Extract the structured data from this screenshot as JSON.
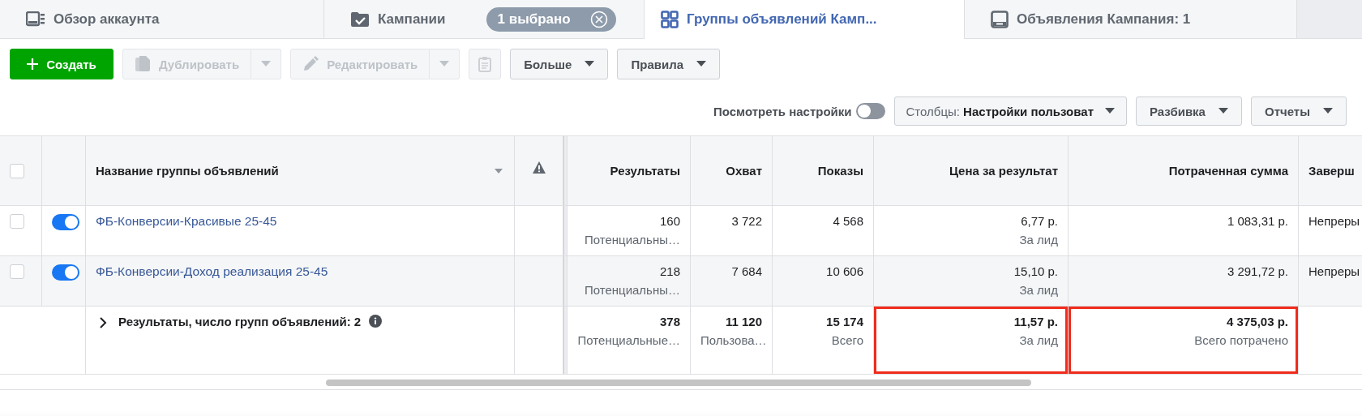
{
  "tabs": [
    {
      "kind": "account",
      "label": "Обзор аккаунта",
      "selected": false
    },
    {
      "kind": "campaigns",
      "label": "Кампании",
      "badge": "1 выбрано",
      "selected": false
    },
    {
      "kind": "adsets",
      "label": "Группы объявлений Камп...",
      "selected": true
    },
    {
      "kind": "ads",
      "label": "Объявления Кампания: 1",
      "selected": false
    }
  ],
  "toolbar": [
    {
      "kind": "create",
      "label": "Создать",
      "disabled": false
    },
    {
      "kind": "duplicate",
      "label": "Дублировать",
      "disabled": true
    },
    {
      "kind": "edit",
      "label": "Редактировать",
      "disabled": true
    },
    {
      "kind": "paste",
      "disabled": true
    },
    {
      "kind": "menu",
      "label": "Больше",
      "disabled": false
    },
    {
      "kind": "menu",
      "label": "Правила",
      "disabled": false
    }
  ],
  "view_settings": {
    "label": "Посмотреть настройки",
    "on": false
  },
  "view_options": [
    {
      "label": "Столбцы:",
      "value": "Настройки пользоват"
    },
    {
      "label": "Разбивка"
    },
    {
      "label": "Отчеты"
    }
  ],
  "table": {
    "select_all_checked": false,
    "columns": [
      {
        "kind": "name",
        "label": "Название группы объявлений"
      },
      {
        "kind": "warning"
      },
      {
        "kind": "number",
        "label": "Результаты"
      },
      {
        "kind": "number",
        "label": "Охват"
      },
      {
        "kind": "number",
        "label": "Показы"
      },
      {
        "kind": "number",
        "label": "Цена за результат"
      },
      {
        "kind": "number",
        "label": "Потраченная сумма"
      },
      {
        "kind": "text",
        "label": "Заверш"
      }
    ],
    "rows": [
      {
        "checked": false,
        "active": true,
        "cells": [
          {
            "value": "ФБ-Конверсии-Красивые 25-45"
          },
          {},
          {
            "value": "160",
            "sub": "Потенциальны…"
          },
          {
            "value": "3 722"
          },
          {
            "value": "4 568"
          },
          {
            "value": "6,77 р.",
            "sub": "За лид"
          },
          {
            "value": "1 083,31 р."
          },
          {
            "value": "Непреры"
          }
        ]
      },
      {
        "checked": false,
        "active": true,
        "cells": [
          {
            "value": "ФБ-Конверсии-Доход реализация 25-45"
          },
          {},
          {
            "value": "218",
            "sub": "Потенциальны…"
          },
          {
            "value": "7 684"
          },
          {
            "value": "10 606"
          },
          {
            "value": "15,10 р.",
            "sub": "За лид"
          },
          {
            "value": "3 291,72 р."
          },
          {
            "value": "Непреры"
          }
        ]
      }
    ],
    "summary": {
      "expanded": false,
      "cells": [
        {
          "value": "Результаты, число групп объявлений: 2"
        },
        {},
        {
          "value": "378",
          "sub": "Потенциальные…",
          "highlighted": false
        },
        {
          "value": "11 120",
          "sub": "Пользова…",
          "highlighted": false
        },
        {
          "value": "15 174",
          "sub": "Всего",
          "highlighted": false
        },
        {
          "value": "11,57 р.",
          "sub": "За лид",
          "highlighted": true
        },
        {
          "value": "4 375,03 р.",
          "sub": "Всего потрачено",
          "highlighted": true
        }
      ]
    }
  }
}
